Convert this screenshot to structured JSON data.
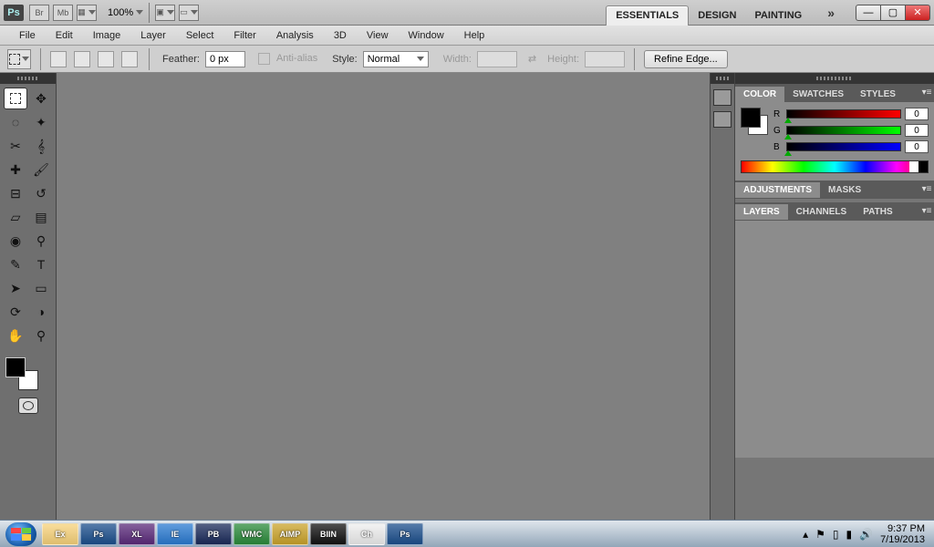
{
  "appbar": {
    "logo": "Ps",
    "chip_br": "Br",
    "chip_mb": "Mb",
    "zoom": "100%",
    "workspaces": [
      "ESSENTIALS",
      "DESIGN",
      "PAINTING"
    ],
    "active_workspace": 0
  },
  "menubar": [
    "File",
    "Edit",
    "Image",
    "Layer",
    "Select",
    "Filter",
    "Analysis",
    "3D",
    "View",
    "Window",
    "Help"
  ],
  "options": {
    "feather_label": "Feather:",
    "feather_value": "0 px",
    "antialias_label": "Anti-alias",
    "style_label": "Style:",
    "style_value": "Normal",
    "width_label": "Width:",
    "height_label": "Height:",
    "refine_label": "Refine Edge..."
  },
  "tools": [
    "dashed-square",
    "move",
    "lasso",
    "quick-select",
    "crop",
    "eyedropper",
    "healing",
    "brush",
    "stamp",
    "history-brush",
    "eraser",
    "gradient",
    "blur",
    "dodge",
    "pen",
    "type",
    "path-select",
    "rectangle",
    "3d-rotate",
    "3d-orbit",
    "hand",
    "zoom"
  ],
  "tool_glyphs": {
    "dashed-square": "▭",
    "move": "✥",
    "lasso": "◌",
    "quick-select": "✦",
    "crop": "✂",
    "eyedropper": "𝄞",
    "healing": "✚",
    "brush": "🖌",
    "stamp": "⊟",
    "history-brush": "↺",
    "eraser": "▱",
    "gradient": "▤",
    "blur": "◉",
    "dodge": "⚲",
    "pen": "✎",
    "type": "T",
    "path-select": "➤",
    "rectangle": "▭",
    "3d-rotate": "⟳",
    "3d-orbit": "◑",
    "hand": "✋",
    "zoom": "⚲"
  },
  "active_tool": 0,
  "color_panel": {
    "tabs": [
      "COLOR",
      "SWATCHES",
      "STYLES"
    ],
    "rgb": {
      "r": 0,
      "g": 0,
      "b": 0
    },
    "r_label": "R",
    "g_label": "G",
    "b_label": "B"
  },
  "adjust_panel": {
    "tabs": [
      "ADJUSTMENTS",
      "MASKS"
    ]
  },
  "layers_panel": {
    "tabs": [
      "LAYERS",
      "CHANNELS",
      "PATHS"
    ]
  },
  "taskbar": {
    "apps": [
      "Explorer",
      "Ps",
      "XL",
      "IE",
      "PB",
      "WMC",
      "AIMP",
      "BIIN",
      "Chrome",
      "Ps"
    ],
    "tray_up": "▴",
    "clock_time": "9:37 PM",
    "clock_date": "7/19/2013"
  }
}
